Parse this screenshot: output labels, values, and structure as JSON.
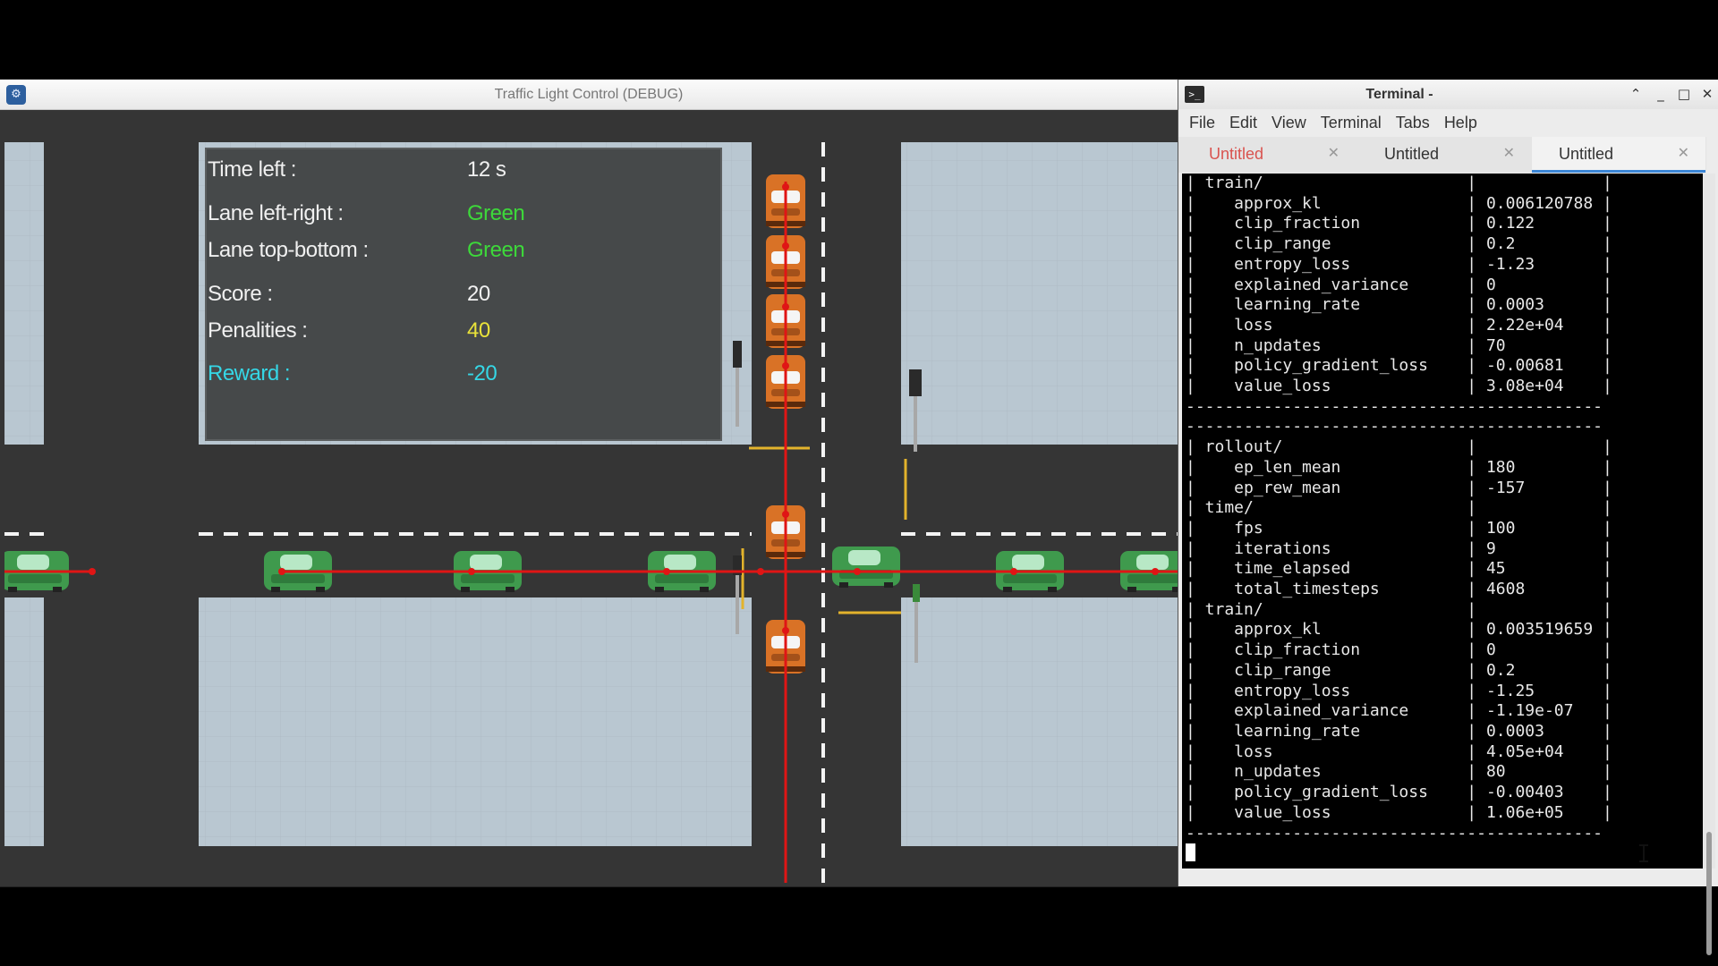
{
  "game_window": {
    "title": "Traffic Light Control (DEBUG)",
    "hud": {
      "time_left": {
        "label": "Time left :",
        "value": "12 s"
      },
      "lane_left_right": {
        "label": "Lane left-right :",
        "value": "Green",
        "color": "#3dd93a"
      },
      "lane_top_bottom": {
        "label": "Lane top-bottom :",
        "value": "Green",
        "color": "#3dd93a"
      },
      "score": {
        "label": "Score :",
        "value": "20"
      },
      "penalities": {
        "label": "Penalities  :",
        "value": "40",
        "color": "#e9e23a"
      },
      "reward": {
        "label": "Reward :",
        "value": "-20",
        "color": "#35d7e6"
      }
    },
    "colors": {
      "road": "#353535",
      "sidewalk": "#b9c7d1",
      "hud_panel": "#46494a",
      "car_horizontal": "#3f9a4d",
      "car_vertical": "#d97226",
      "debug_line": "#e01515"
    }
  },
  "terminal_window": {
    "title": "Terminal -",
    "menu": [
      "File",
      "Edit",
      "View",
      "Terminal",
      "Tabs",
      "Help"
    ],
    "tabs": [
      {
        "label": "Untitled",
        "color": "#d9534f",
        "active": false
      },
      {
        "label": "Untitled",
        "color": "#333333",
        "active": false
      },
      {
        "label": "Untitled",
        "color": "#333333",
        "active": true
      }
    ],
    "lines": [
      "| train/                     |             |",
      "|    approx_kl               | 0.006120788 |",
      "|    clip_fraction           | 0.122       |",
      "|    clip_range              | 0.2         |",
      "|    entropy_loss            | -1.23       |",
      "|    explained_variance      | 0           |",
      "|    learning_rate           | 0.0003      |",
      "|    loss                    | 2.22e+04    |",
      "|    n_updates               | 70          |",
      "|    policy_gradient_loss    | -0.00681    |",
      "|    value_loss              | 3.08e+04    |",
      "-------------------------------------------",
      "-------------------------------------------",
      "| rollout/                   |             |",
      "|    ep_len_mean             | 180         |",
      "|    ep_rew_mean             | -157        |",
      "| time/                      |             |",
      "|    fps                     | 100         |",
      "|    iterations              | 9           |",
      "|    time_elapsed            | 45          |",
      "|    total_timesteps         | 4608        |",
      "| train/                     |             |",
      "|    approx_kl               | 0.003519659 |",
      "|    clip_fraction           | 0           |",
      "|    clip_range              | 0.2         |",
      "|    entropy_loss            | -1.25       |",
      "|    explained_variance      | -1.19e-07   |",
      "|    learning_rate           | 0.0003      |",
      "|    loss                    | 4.05e+04    |",
      "|    n_updates               | 80          |",
      "|    policy_gradient_loss    | -0.00403    |",
      "|    value_loss              | 1.06e+05    |",
      "-------------------------------------------"
    ]
  }
}
